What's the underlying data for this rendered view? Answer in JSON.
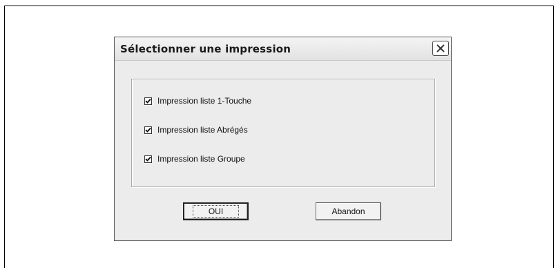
{
  "dialog": {
    "title": "Sélectionner une impression",
    "close_icon": "close-icon",
    "options": [
      {
        "label": "Impression liste 1-Touche",
        "checked": true
      },
      {
        "label": "Impression liste Abrégés",
        "checked": true
      },
      {
        "label": "Impression liste Groupe",
        "checked": true
      }
    ],
    "ok_label": "OUI",
    "cancel_label": "Abandon"
  }
}
